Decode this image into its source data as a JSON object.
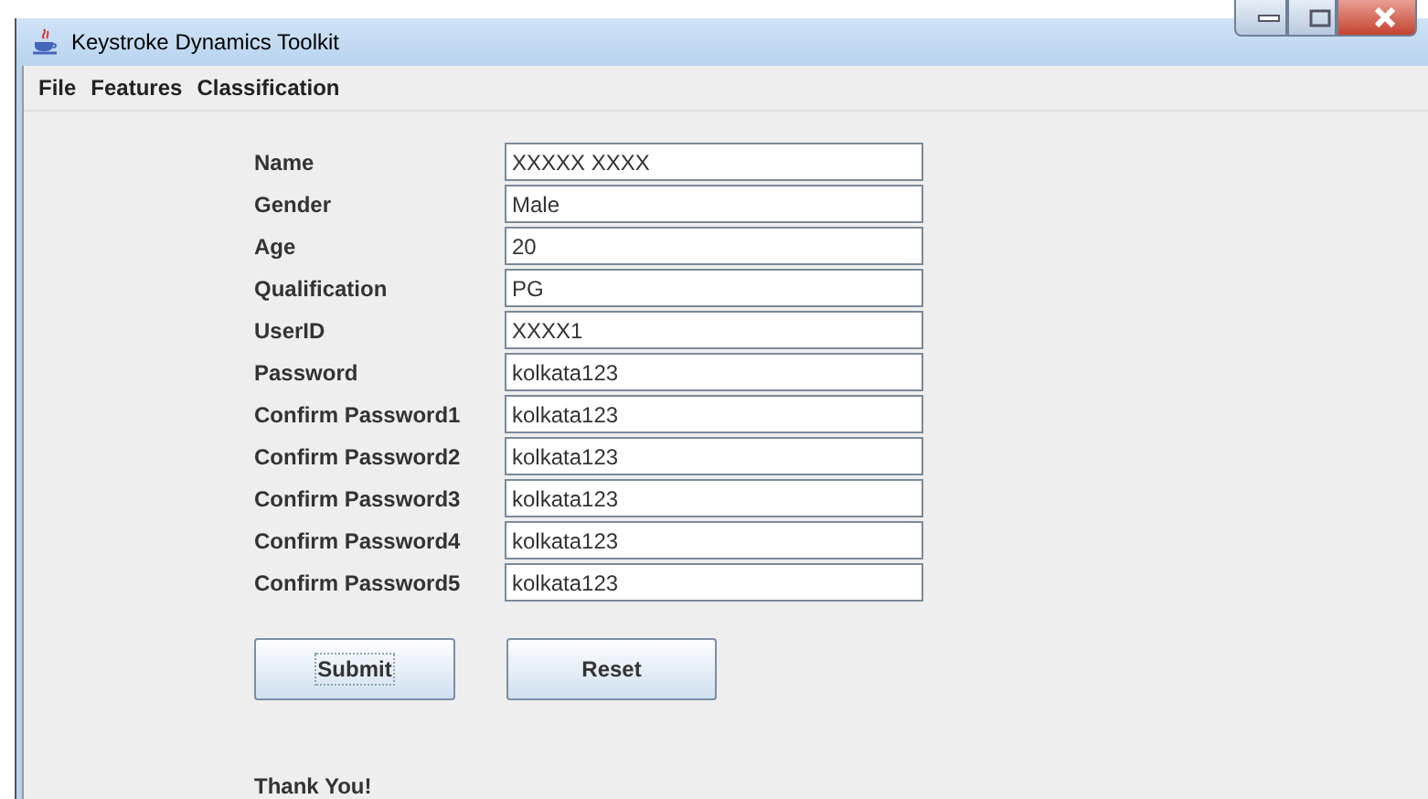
{
  "window": {
    "title": "Keystroke Dynamics Toolkit"
  },
  "menu": [
    "File",
    "Features",
    "Classification"
  ],
  "form": [
    {
      "label": "Name",
      "value": "XXXXX XXXX"
    },
    {
      "label": "Gender",
      "value": "Male"
    },
    {
      "label": "Age",
      "value": "20"
    },
    {
      "label": "Qualification",
      "value": "PG"
    },
    {
      "label": "UserID",
      "value": "XXXX1"
    },
    {
      "label": "Password",
      "value": "kolkata123"
    },
    {
      "label": "Confirm Password1",
      "value": "kolkata123"
    },
    {
      "label": "Confirm Password2",
      "value": "kolkata123"
    },
    {
      "label": "Confirm Password3",
      "value": "kolkata123"
    },
    {
      "label": "Confirm Password4",
      "value": "kolkata123"
    },
    {
      "label": "Confirm Password5",
      "value": "kolkata123"
    }
  ],
  "buttons": [
    {
      "label": "Submit",
      "focused": true
    },
    {
      "label": "Reset",
      "focused": false
    }
  ],
  "message": "Thank You!"
}
